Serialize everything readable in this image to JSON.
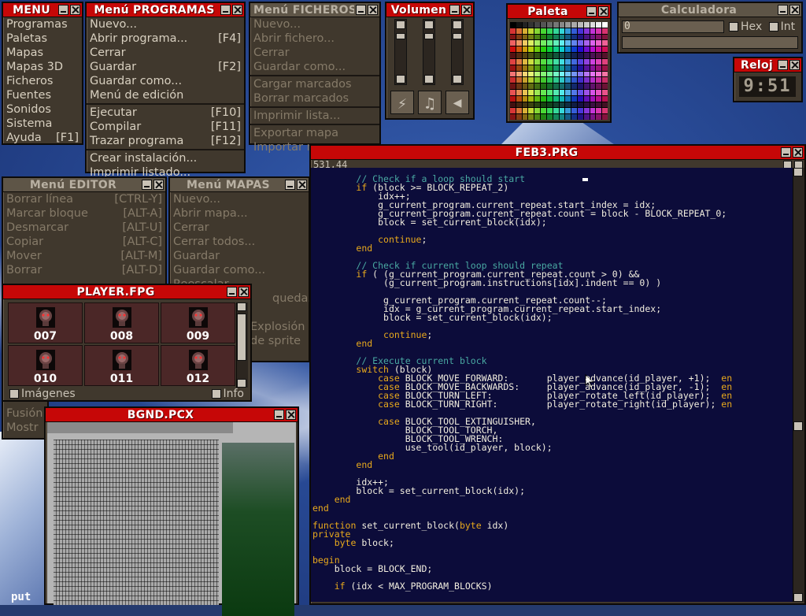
{
  "menu": {
    "title": "MENU",
    "items": [
      "Programas",
      "Paletas",
      "Mapas",
      "Mapas 3D",
      "Ficheros",
      "Fuentes",
      "Sonidos",
      "Sistema",
      "Ayuda"
    ],
    "ayuda_shortcut": "[F1]"
  },
  "programs_menu": {
    "title": "Menú PROGRAMAS",
    "items": [
      {
        "label": "Nuevo...",
        "key": ""
      },
      {
        "label": "Abrir programa...",
        "key": "[F4]"
      },
      {
        "label": "Cerrar",
        "key": ""
      },
      {
        "label": "Guardar",
        "key": "[F2]"
      },
      {
        "label": "Guardar como...",
        "key": ""
      },
      {
        "label": "Menú de edición",
        "key": ""
      },
      {
        "label": "Ejecutar",
        "key": "[F10]"
      },
      {
        "label": "Compilar",
        "key": "[F11]"
      },
      {
        "label": "Trazar programa",
        "key": "[F12]"
      },
      {
        "label": "Crear instalación...",
        "key": ""
      },
      {
        "label": "Imprimir listado...",
        "key": ""
      }
    ]
  },
  "files_menu": {
    "title": "Menú FICHEROS",
    "items": [
      "Nuevo...",
      "Abrir fichero...",
      "Cerrar",
      "Guardar como...",
      "Cargar marcados",
      "Borrar marcados",
      "Imprimir lista...",
      "Exportar mapa",
      "Importar mapa"
    ]
  },
  "volume": {
    "title": "Volumen",
    "levels": [
      0.9,
      0.9,
      0.9
    ]
  },
  "palette": {
    "title": "Paleta"
  },
  "calculator": {
    "title": "Calculadora",
    "value": "0",
    "hex_label": "Hex",
    "int_label": "Int"
  },
  "clock": {
    "title": "Reloj",
    "time": "9:51"
  },
  "editor_menu": {
    "title": "Menú EDITOR",
    "items": [
      {
        "label": "Borrar línea",
        "key": "[CTRL-Y]"
      },
      {
        "label": "Marcar bloque",
        "key": "[ALT-A]"
      },
      {
        "label": "Desmarcar",
        "key": "[ALT-U]"
      },
      {
        "label": "Copiar",
        "key": "[ALT-C]"
      },
      {
        "label": "Mover",
        "key": "[ALT-M]"
      },
      {
        "label": "Borrar",
        "key": "[ALT-D]"
      }
    ]
  },
  "maps_menu": {
    "title": "Menú MAPAS",
    "items": [
      "Nuevo...",
      "Abrir mapa...",
      "Cerrar",
      "Cerrar todos...",
      "Guardar",
      "Guardar como...",
      "Reescalar"
    ]
  },
  "hidden_fragments": [
    "queda...",
    "Explosión",
    "de sprite",
    "Fusión",
    "Mostr"
  ],
  "player": {
    "title": "PLAYER.FPG",
    "codes": [
      "007",
      "008",
      "009",
      "010",
      "011",
      "012"
    ],
    "images_label": "Imágenes",
    "info_label": "Info"
  },
  "bgnd": {
    "title": "BGND.PCX"
  },
  "desktop_text": "put",
  "code_editor": {
    "title": "FEB3.PRG",
    "position": "531,44",
    "lines": [
      {
        "i": "        ",
        "s": [
          [
            "cm",
            "// Check if a loop should start"
          ]
        ]
      },
      {
        "i": "        ",
        "s": [
          [
            "kw",
            "if "
          ],
          [
            "tx",
            "(block >= BLOCK_REPEAT_2)"
          ]
        ]
      },
      {
        "i": "            ",
        "s": [
          [
            "tx",
            "idx++;"
          ]
        ]
      },
      {
        "i": "            ",
        "s": [
          [
            "tx",
            "g_current_program.current_repeat.start_index = idx;"
          ]
        ]
      },
      {
        "i": "            ",
        "s": [
          [
            "tx",
            "g_current_program.current_repeat.count = block - BLOCK_REPEAT_0;"
          ]
        ]
      },
      {
        "i": "            ",
        "s": [
          [
            "tx",
            "block = set_current_block(idx);"
          ]
        ]
      },
      {
        "i": "",
        "s": []
      },
      {
        "i": "            ",
        "s": [
          [
            "kw",
            "continue"
          ],
          [
            "tx",
            ";"
          ]
        ]
      },
      {
        "i": "        ",
        "s": [
          [
            "kw",
            "end"
          ]
        ]
      },
      {
        "i": "",
        "s": []
      },
      {
        "i": "        ",
        "s": [
          [
            "cm",
            "// Check if current loop should repeat"
          ]
        ]
      },
      {
        "i": "        ",
        "s": [
          [
            "kw",
            "if "
          ],
          [
            "tx",
            "( (g_current_program.current_repeat.count > 0) &&"
          ]
        ]
      },
      {
        "i": "             ",
        "s": [
          [
            "tx",
            "(g_current_program.instructions[idx].indent == 0) )"
          ]
        ]
      },
      {
        "i": "",
        "s": []
      },
      {
        "i": "             ",
        "s": [
          [
            "tx",
            "g_current_program.current_repeat.count--;"
          ]
        ]
      },
      {
        "i": "             ",
        "s": [
          [
            "tx",
            "idx = g_current_program.current_repeat.start_index;"
          ]
        ]
      },
      {
        "i": "             ",
        "s": [
          [
            "tx",
            "block = set_current_block(idx);"
          ]
        ]
      },
      {
        "i": "",
        "s": []
      },
      {
        "i": "             ",
        "s": [
          [
            "kw",
            "continue"
          ],
          [
            "tx",
            ";"
          ]
        ]
      },
      {
        "i": "        ",
        "s": [
          [
            "kw",
            "end"
          ]
        ]
      },
      {
        "i": "",
        "s": []
      },
      {
        "i": "        ",
        "s": [
          [
            "cm",
            "// Execute current block"
          ]
        ]
      },
      {
        "i": "        ",
        "s": [
          [
            "kw",
            "switch "
          ],
          [
            "tx",
            "(block)"
          ]
        ]
      },
      {
        "i": "            ",
        "s": [
          [
            "kw",
            "case "
          ],
          [
            "tx",
            "BLOCK_MOVE_FORWARD:       player_advance(id_player, +1);  "
          ],
          [
            "kw",
            "en"
          ]
        ]
      },
      {
        "i": "            ",
        "s": [
          [
            "kw",
            "case "
          ],
          [
            "tx",
            "BLOCK_MOVE_BACKWARDS:     player_advance(id_player, -1);  "
          ],
          [
            "kw",
            "en"
          ]
        ]
      },
      {
        "i": "            ",
        "s": [
          [
            "kw",
            "case "
          ],
          [
            "tx",
            "BLOCK_TURN_LEFT:          player_rotate_left(id_player);  "
          ],
          [
            "kw",
            "en"
          ]
        ]
      },
      {
        "i": "            ",
        "s": [
          [
            "kw",
            "case "
          ],
          [
            "tx",
            "BLOCK_TURN_RIGHT:         player_rotate_right(id_player); "
          ],
          [
            "kw",
            "en"
          ]
        ]
      },
      {
        "i": "",
        "s": []
      },
      {
        "i": "            ",
        "s": [
          [
            "kw",
            "case "
          ],
          [
            "tx",
            "BLOCK_TOOL_EXTINGUISHER,"
          ]
        ]
      },
      {
        "i": "                 ",
        "s": [
          [
            "tx",
            "BLOCK_TOOL_TORCH,"
          ]
        ]
      },
      {
        "i": "                 ",
        "s": [
          [
            "tx",
            "BLOCK_TOOL_WRENCH:"
          ]
        ]
      },
      {
        "i": "                 ",
        "s": [
          [
            "tx",
            "use_tool(id_player, block);"
          ]
        ]
      },
      {
        "i": "            ",
        "s": [
          [
            "kw",
            "end"
          ]
        ]
      },
      {
        "i": "        ",
        "s": [
          [
            "kw",
            "end"
          ]
        ]
      },
      {
        "i": "",
        "s": []
      },
      {
        "i": "        ",
        "s": [
          [
            "tx",
            "idx++;"
          ]
        ]
      },
      {
        "i": "        ",
        "s": [
          [
            "tx",
            "block = set_current_block(idx);"
          ]
        ]
      },
      {
        "i": "    ",
        "s": [
          [
            "kw",
            "end"
          ]
        ]
      },
      {
        "i": "",
        "s": [
          [
            "kw",
            "end"
          ]
        ]
      },
      {
        "i": "",
        "s": []
      },
      {
        "i": "",
        "s": [
          [
            "kw",
            "function "
          ],
          [
            "tx",
            "set_current_block("
          ],
          [
            "kw",
            "byte "
          ],
          [
            "tx",
            "idx)"
          ]
        ]
      },
      {
        "i": "",
        "s": [
          [
            "kw",
            "private"
          ]
        ]
      },
      {
        "i": "    ",
        "s": [
          [
            "kw",
            "byte "
          ],
          [
            "tx",
            "block;"
          ]
        ]
      },
      {
        "i": "",
        "s": []
      },
      {
        "i": "",
        "s": [
          [
            "kw",
            "begin"
          ]
        ]
      },
      {
        "i": "    ",
        "s": [
          [
            "tx",
            "block = BLOCK_END;"
          ]
        ]
      },
      {
        "i": "",
        "s": []
      },
      {
        "i": "    ",
        "s": [
          [
            "kw",
            "if "
          ],
          [
            "tx",
            "(idx < MAX_PROGRAM_BLOCKS)"
          ]
        ]
      }
    ]
  }
}
